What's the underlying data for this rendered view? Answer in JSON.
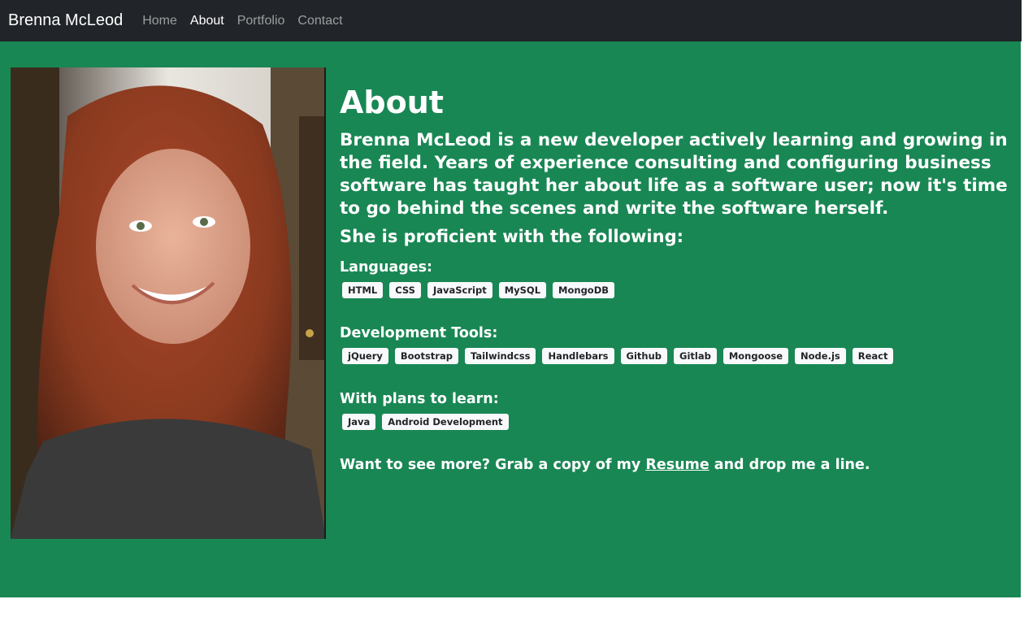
{
  "navbar": {
    "brand": "Brenna McLeod",
    "links": [
      {
        "label": "Home"
      },
      {
        "label": "About"
      },
      {
        "label": "Portfolio"
      },
      {
        "label": "Contact"
      }
    ]
  },
  "about": {
    "title": "About",
    "intro": "Brenna McLeod is a new developer actively learning and growing in the field. Years of experience consulting and configuring business software has taught her about life as a software user; now it's time to go behind the scenes and write the software herself.",
    "proficient": "She is proficient with the following:",
    "languages": {
      "title": "Languages:",
      "items": [
        "HTML",
        "CSS",
        "JavaScript",
        "MySQL",
        "MongoDB"
      ]
    },
    "tools": {
      "title": "Development Tools:",
      "items": [
        "jQuery",
        "Bootstrap",
        "Tailwindcss",
        "Handlebars",
        "Github",
        "Gitlab",
        "Mongoose",
        "Node.js",
        "React"
      ]
    },
    "plans": {
      "title": "With plans to learn:",
      "items": [
        "Java",
        "Android Development"
      ]
    },
    "cta": {
      "before": "Want to see more? Grab a copy of my ",
      "link": "Resume",
      "after": " and drop me a line."
    }
  },
  "colors": {
    "navbar": "#212529",
    "main": "#198754",
    "badge": "#f8f9fa"
  }
}
